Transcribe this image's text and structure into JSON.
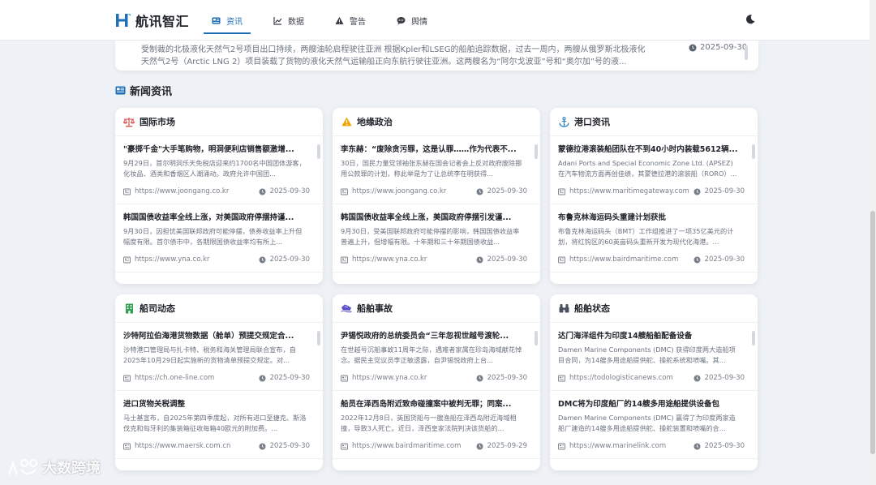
{
  "brand": {
    "name": "航讯智汇",
    "accent": "#1d6fb8"
  },
  "nav": [
    {
      "label": "资讯",
      "icon": "newspaper-icon",
      "active": true
    },
    {
      "label": "数据",
      "icon": "chart-icon",
      "active": false
    },
    {
      "label": "警告",
      "icon": "warning-icon",
      "active": false
    },
    {
      "label": "舆情",
      "icon": "comment-icon",
      "active": false
    }
  ],
  "theme_toggle": {
    "icon": "moon-icon"
  },
  "strip": {
    "text": "受制裁的北极液化天然气2号项目出口持续，两艘油轮启程驶往亚洲 根据Kpler和LSEG的船舶追踪数据，过去一周内，两艘从俄罗斯北极液化天然气2号（Arctic LNG 2）项目装载了货物的液化天然气运输船正向东航行驶往亚洲。这两艘名为“阿尔戈波亚”号和“奥尔加”号的液...",
    "date": "2025-09-30"
  },
  "section": {
    "title": "新闻资讯",
    "icon": "newspaper-icon"
  },
  "cards": [
    {
      "title": "国际市场",
      "icon": "scale-icon",
      "icon_color": "#d9534f",
      "items": [
        {
          "title": "\"豪掷千金\"大手笔购物，明洞便利店销售额激增...",
          "summary": "9月29日，首尔明洞乐天免税店迎来约1700名中国团体游客，化妆品、酒类和香烟区人潮涌动。政府允许中国团...",
          "source": "https://www.joongang.co.kr",
          "date": "2025-09-30"
        },
        {
          "title": "韩国国债收益率全线上涨，对美国政府停摆持谨...",
          "summary": "9月30日，因担忧美国联邦政府可能停摆，债券收益率上升但幅度有限。首尔债市中，各期限国债收益率均有所上...",
          "source": "https://www.yna.co.kr",
          "date": "2025-09-30"
        }
      ]
    },
    {
      "title": "地缘政治",
      "icon": "warning-icon",
      "icon_color": "#f0a500",
      "items": [
        {
          "title": "李东赫：“废除贪污罪，这是认罪……作为代表不...",
          "summary": "30日，国民力量党领袖张东赫在国会记者会上反对政府废除挪用公款罪的计划，称此举是为了让总统李在明获得...",
          "source": "https://www.joongang.co.kr",
          "date": "2025-09-30"
        },
        {
          "title": "韩国国债收益率全线上涨，美国政府停摆引发谨...",
          "summary": "9月30日，受美国联邦政府可能停摆的影响，韩国国债收益率普遍上升，但增幅有限。十年期和三十年期国债收益...",
          "source": "https://www.yna.co.kr",
          "date": "2025-09-30"
        }
      ]
    },
    {
      "title": "港口资讯",
      "icon": "anchor-icon",
      "icon_color": "#2f7fc1",
      "items": [
        {
          "title": "蒙德拉港滚装船团队在不到40小时内装载5612辆...",
          "summary": "Adani Ports and Special Economic Zone Ltd. (APSEZ) 在汽车物流方面再创佳绩，其蒙德拉港的滚装船（RORO）...",
          "source": "https://www.maritimegateway.com",
          "date": "2025-09-30"
        },
        {
          "title": "布鲁克林海运码头重建计划获批",
          "summary": "布鲁克林海运码头（BMT）工作组推进了一项35亿美元的计划，将红钩区的60英亩码头重新开发为现代化海港。...",
          "source": "https://www.bairdmaritime.com",
          "date": "2025-09-30"
        }
      ]
    },
    {
      "title": "船司动态",
      "icon": "building-icon",
      "icon_color": "#2e9e4f",
      "items": [
        {
          "title": "沙特阿拉伯海港货物数据（舱单）预提交规定合...",
          "summary": "沙特港口管理局与扎卡特、税务和海关管理局联合宣布，自2025年10月29日起实施新的货物清单预提交规定。对...",
          "source": "https://ch.one-line.com",
          "date": "2025-09-30"
        },
        {
          "title": "进口货物关税调整",
          "summary": "马士基宣布，自2025年第四季度起，对所有进口至捷克、斯洛伐克和匈牙利的集装箱征收每箱40欧元的附加费。...",
          "source": "https://www.maersk.com.cn",
          "date": "2025-09-30"
        }
      ]
    },
    {
      "title": "船舶事故",
      "icon": "ship-icon",
      "icon_color": "#5b4fc7",
      "items": [
        {
          "title": "尹锡悦政府的总统委员会“三年忽视世越号渡轮...",
          "summary": "在世越号沉船事故11周年之际，遇难者家属在珍岛海域献花悼念。据民主党议员李正敏透露，自尹锡悦政府上台...",
          "source": "https://www.yna.co.kr",
          "date": "2025-09-30"
        },
        {
          "title": "船员在泽西岛附近致命碰撞案中被判无罪；同案...",
          "summary": "2022年12月8日，英国货船与一艘渔船在泽西岛附近海域相撞，导致3人死亡。近日，泽西皇家法院判决该货船的...",
          "source": "https://www.bairdmaritime.com",
          "date": "2025-09-29"
        }
      ]
    },
    {
      "title": "船舶状态",
      "icon": "binoculars-icon",
      "icon_color": "#4a5260",
      "items": [
        {
          "title": "达门海洋组件为印度14艘船舶配备设备",
          "summary": "Damen Marine Components (DMC) 获得印度两大造船项目合同，为14艘多用途船提供舵、操舵系统和喷嘴。其...",
          "source": "https://todologisticanews.com",
          "date": "2025-09-30"
        },
        {
          "title": "DMC将为印度船厂的14艘多用途船提供设备包",
          "summary": "Damen Marine Components (DMC) 赢得了为印度两家造船厂建造的14艘多用途船提供舵、操舵装置和喷嘴的合...",
          "source": "https://www.marinelink.com",
          "date": "2025-09-30"
        }
      ]
    }
  ],
  "watermark": {
    "text": "大数跨境"
  }
}
